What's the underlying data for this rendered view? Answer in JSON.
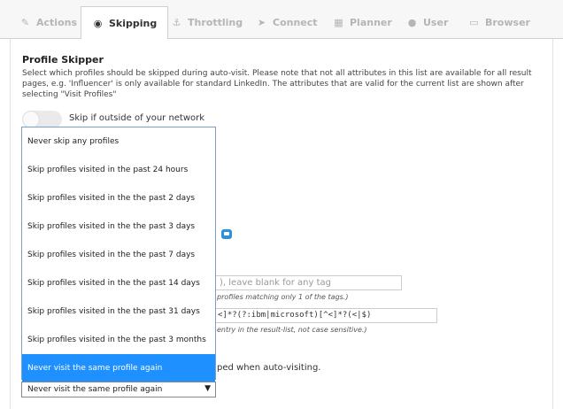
{
  "tabs": [
    {
      "label": "Actions",
      "icon": "magic-wand-icon",
      "glyph": "✎"
    },
    {
      "label": "Skipping",
      "icon": "eye-slash-icon",
      "glyph": "◉"
    },
    {
      "label": "Throttling",
      "icon": "anchor-icon",
      "glyph": "⚓"
    },
    {
      "label": "Connect",
      "icon": "paper-plane-icon",
      "glyph": "➤"
    },
    {
      "label": "Planner",
      "icon": "calendar-icon",
      "glyph": "▦"
    },
    {
      "label": "User",
      "icon": "user-icon",
      "glyph": "●"
    },
    {
      "label": "Browser",
      "icon": "laptop-icon",
      "glyph": "▭"
    }
  ],
  "active_tab": "Skipping",
  "profile_skipper": {
    "title": "Profile Skipper",
    "description": "Select which profiles should be skipped during auto-visit. Please note that not all attributes in this list are available for all result pages, e.g. 'Influencer' is only available for standard LinkedIn. The attributes that are valid for the current list are shown after selecting \"Visit Profiles\"",
    "toggle_label": "Skip if outside of your network",
    "toggle_on": false
  },
  "tags_input": {
    "visible_text": "), leave blank for any tag",
    "hint": "profiles matching only 1 of the tags.)"
  },
  "regex_input": {
    "value": "<]*?(?:ibm|microsoft)[^<]*?(<|$)",
    "hint": "entry in the result-list, not case sensitive.)"
  },
  "skipped_text": "ped when auto-visiting.",
  "dropdown": {
    "options": [
      "Never skip any profiles",
      "Skip profiles visited in the past 24 hours",
      "Skip profiles visited in the the past 2 days",
      "Skip profiles visited in the the past 3 days",
      "Skip profiles visited in the the past 7 days",
      "Skip profiles visited in the the past 14 days",
      "Skip profiles visited in the the past 31 days",
      "Skip profiles visited in the the past 3 months",
      "Never visit the same profile again"
    ],
    "highlighted_index": 8,
    "selected_value": "Never visit the same profile again",
    "arrow": "▼"
  },
  "colors": {
    "accent": "#1e90ff",
    "inactive_tab": "#b5b5b5",
    "blue_button": "#2f8fd8"
  }
}
